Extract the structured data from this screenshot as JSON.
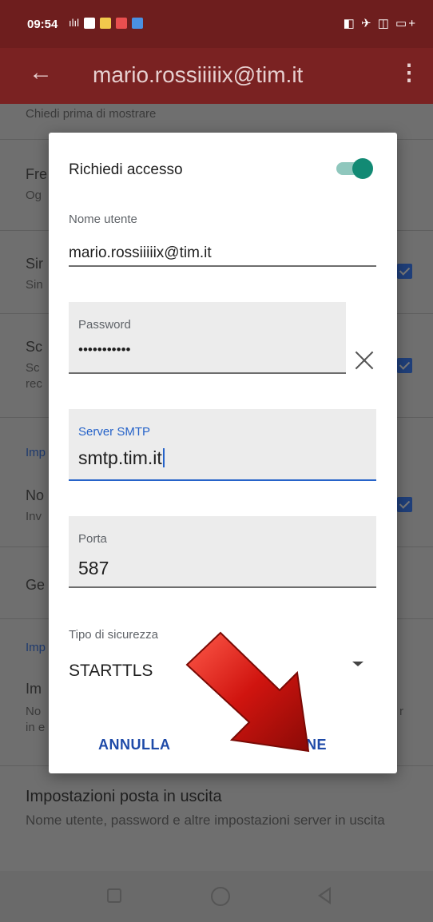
{
  "status_bar": {
    "time": "09:54"
  },
  "app_bar": {
    "title": "mario.rossiiiiix@tim.it"
  },
  "background": {
    "row0_sub": "Chiedi prima di mostrare",
    "row1_title": "Fre",
    "row1_sub": "Og",
    "row2_title": "Sir",
    "row2_sub": "Sin",
    "row3_title": "Sc",
    "row3_sub_a": "Sc",
    "row3_sub_b": "rec",
    "section1": "Imp",
    "row4_title": "No",
    "row4_sub": "Inv",
    "row5_title": "Ge",
    "section2": "Imp",
    "row6_title": "Im",
    "row6_sub_a": "No",
    "row6_sub_b": "in e",
    "row6_right_a": "r",
    "bottom_title": "Impostazioni posta in uscita",
    "bottom_sub": "Nome utente, password e altre impostazioni server in uscita"
  },
  "dialog": {
    "request_access_label": "Richiedi accesso",
    "toggle_on": true,
    "username": {
      "label": "Nome utente",
      "value": "mario.rossiiiiix@tim.it"
    },
    "password": {
      "label": "Password",
      "value": "•••••••••••"
    },
    "smtp": {
      "label": "Server SMTP",
      "value": "smtp.tim.it"
    },
    "port": {
      "label": "Porta",
      "value": "587"
    },
    "security": {
      "label": "Tipo di sicurezza",
      "value": "STARTTLS"
    },
    "cancel_label": "ANNULLA",
    "done_label": "FINE"
  },
  "colors": {
    "app_bar": "#7a2222",
    "toggle_thumb": "#128a74",
    "accent_blue": "#2663c9",
    "button_text": "#1e4aa8",
    "arrow_red": "#c8100c"
  }
}
